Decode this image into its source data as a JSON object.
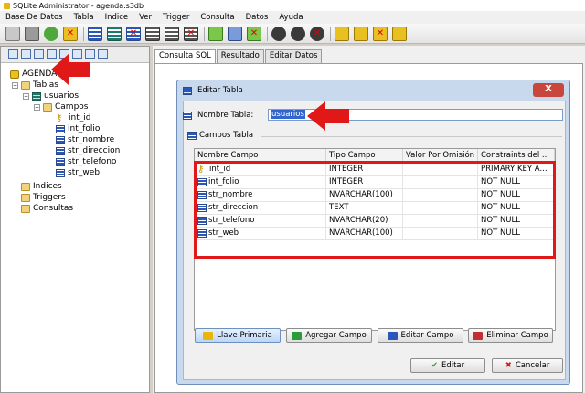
{
  "window": {
    "title": "SQLite Administrator - agenda.s3db"
  },
  "menu": [
    "Base De Datos",
    "Tabla",
    "Indice",
    "Ver",
    "Trigger",
    "Consulta",
    "Datos",
    "Ayuda"
  ],
  "tree": {
    "root": "AGENDA",
    "tablas": "Tablas",
    "table": "usuarios",
    "campos": "Campos",
    "fields": [
      "int_id",
      "int_folio",
      "str_nombre",
      "str_direccion",
      "str_telefono",
      "str_web"
    ],
    "indices": "Indices",
    "triggers": "Triggers",
    "consultas": "Consultas"
  },
  "tabs": [
    "Consulta SQL",
    "Resultado",
    "Editar Datos"
  ],
  "dialog": {
    "title": "Editar Tabla",
    "close": "X",
    "name_label": "Nombre Tabla:",
    "name_value": "usuarios",
    "fieldset_label": "Campos Tabla",
    "columns": [
      "Nombre Campo",
      "Tipo Campo",
      "Valor Por Omisión",
      "Constraints del ..."
    ],
    "rows": [
      {
        "name": "int_id",
        "type": "INTEGER",
        "default": "",
        "constraints": "PRIMARY KEY A...",
        "key": true
      },
      {
        "name": "int_folio",
        "type": "INTEGER",
        "default": "",
        "constraints": "NOT NULL",
        "key": false
      },
      {
        "name": "str_nombre",
        "type": "NVARCHAR(100)",
        "default": "",
        "constraints": "NOT NULL",
        "key": false
      },
      {
        "name": "str_direccion",
        "type": "TEXT",
        "default": "",
        "constraints": "NOT NULL",
        "key": false
      },
      {
        "name": "str_telefono",
        "type": "NVARCHAR(20)",
        "default": "",
        "constraints": "NOT NULL",
        "key": false
      },
      {
        "name": "str_web",
        "type": "NVARCHAR(100)",
        "default": "",
        "constraints": "NOT NULL",
        "key": false
      }
    ],
    "buttons": {
      "llave": "Llave Primaria",
      "agregar": "Agregar Campo",
      "editar_campo": "Editar Campo",
      "eliminar": "Eliminar Campo",
      "editar": "Editar",
      "cancelar": "Cancelar"
    }
  },
  "colors": {
    "highlight_red": "#e01818",
    "dialog_frame": "#c9d9ed",
    "selection": "#3366cc"
  }
}
